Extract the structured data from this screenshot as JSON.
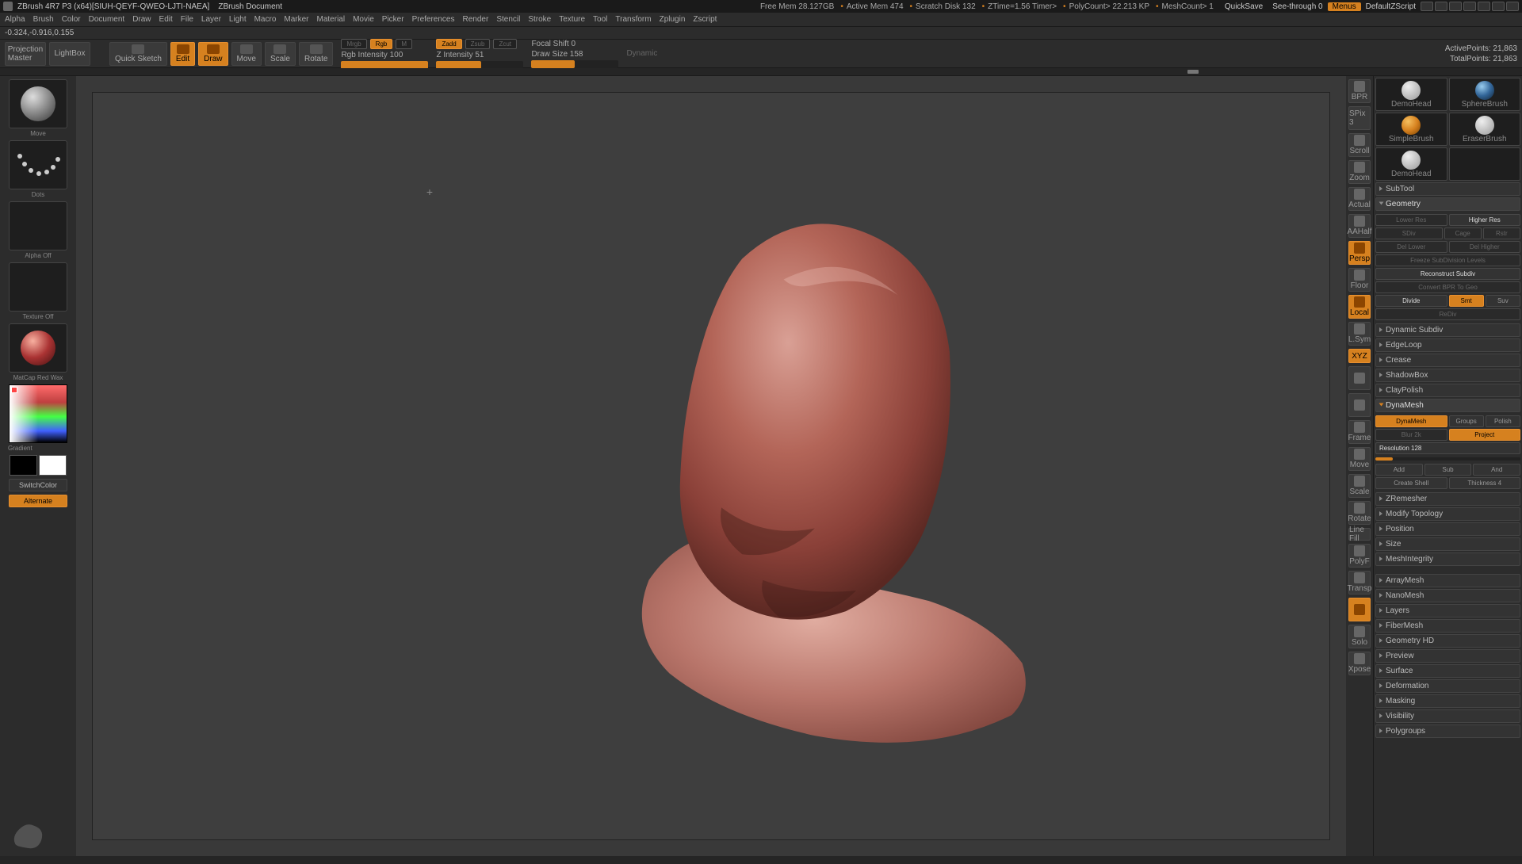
{
  "title": "ZBrush 4R7 P3 (x64)[SIUH-QEYF-QWEO-LJTI-NAEA]",
  "doc_title": "ZBrush Document",
  "stats": {
    "free_mem": "Free Mem 28.127GB",
    "active_mem": "Active Mem 474",
    "scratch": "Scratch Disk 132",
    "ztime": "ZTime=1.56 Timer>",
    "poly": "PolyCount> 22.213 KP",
    "mesh": "MeshCount> 1"
  },
  "top_buttons": {
    "quicksave": "QuickSave",
    "seethrough": "See-through  0",
    "menus": "Menus",
    "defaultz": "DefaultZScript"
  },
  "menu": [
    "Alpha",
    "Brush",
    "Color",
    "Document",
    "Draw",
    "Edit",
    "File",
    "Layer",
    "Light",
    "Macro",
    "Marker",
    "Material",
    "Movie",
    "Picker",
    "Preferences",
    "Render",
    "Stencil",
    "Stroke",
    "Texture",
    "Tool",
    "Transform",
    "Zplugin",
    "Zscript"
  ],
  "status_coords": "-0.324,-0.916,0.155",
  "toolbar": {
    "proj_master": "Projection Master",
    "lightbox": "LightBox",
    "quicksketch": "Quick Sketch",
    "edit": "Edit",
    "draw": "Draw",
    "move": "Move",
    "scale": "Scale",
    "rotate": "Rotate",
    "mrgb": "Mrgb",
    "rgb": "Rgb",
    "m": "M",
    "rgb_int": "Rgb Intensity 100",
    "zadd": "Zadd",
    "zsub": "Zsub",
    "zcut": "Zcut",
    "z_int": "Z Intensity 51",
    "focal": "Focal Shift 0",
    "drawsize": "Draw Size 158",
    "dynamic": "Dynamic",
    "active_pts": "ActivePoints: 21,863",
    "total_pts": "TotalPoints: 21,863"
  },
  "left": {
    "move": "Move",
    "dots": "Dots",
    "alpha": "Alpha Off",
    "texture": "Texture Off",
    "matcap": "MatCap Red Wax",
    "gradient": "Gradient",
    "switchcolor": "SwitchColor",
    "alternate": "Alternate"
  },
  "rstrip": [
    "BPR",
    "SPix 3",
    "Scroll",
    "Zoom",
    "Actual",
    "AAHalf",
    "Persp",
    "Floor",
    "Local",
    "L.Sym",
    "XYZ",
    "",
    "",
    "Frame",
    "Move",
    "Scale",
    "Rotate",
    "Line Fill",
    "PolyF",
    "Transp",
    "",
    "Solo",
    "Xpose"
  ],
  "brushes": {
    "a": "DemoHead",
    "b": "SphereBrush",
    "c": "SimpleBrush",
    "d": "EraserBrush",
    "e": "DemoHead"
  },
  "sections": {
    "subtool": "SubTool",
    "geometry": "Geometry"
  },
  "geom": {
    "lower": "Lower Res",
    "higher": "Higher Res",
    "sdiv": "SDiv",
    "cage": "Cage",
    "rstr": "Rstr",
    "dellower": "Del Lower",
    "delhigher": "Del Higher",
    "freeze": "Freeze SubDivision Levels",
    "recon": "Reconstruct Subdiv",
    "convert": "Convert BPR To Geo",
    "divide": "Divide",
    "smt": "Smt",
    "suv": "Suv",
    "rediv": "ReDiv",
    "dynsub": "Dynamic Subdiv",
    "edgeloop": "EdgeLoop",
    "crease": "Crease",
    "shadowbox": "ShadowBox",
    "claypolish": "ClayPolish",
    "dynamesh": "DynaMesh",
    "dynamesh_btn": "DynaMesh",
    "groups": "Groups",
    "polish": "Polish",
    "blur": "Blur 2k",
    "project": "Project",
    "res": "Resolution 128",
    "add": "Add",
    "sub": "Sub",
    "and": "And",
    "createshell": "Create Shell",
    "thickness": "Thickness 4",
    "zremesher": "ZRemesher",
    "modtopo": "Modify Topology",
    "position": "Position",
    "size": "Size",
    "meshint": "MeshIntegrity"
  },
  "sections2": [
    "ArrayMesh",
    "NanoMesh",
    "Layers",
    "FiberMesh",
    "Geometry HD",
    "Preview",
    "Surface",
    "Deformation",
    "Masking",
    "Visibility",
    "Polygroups"
  ]
}
